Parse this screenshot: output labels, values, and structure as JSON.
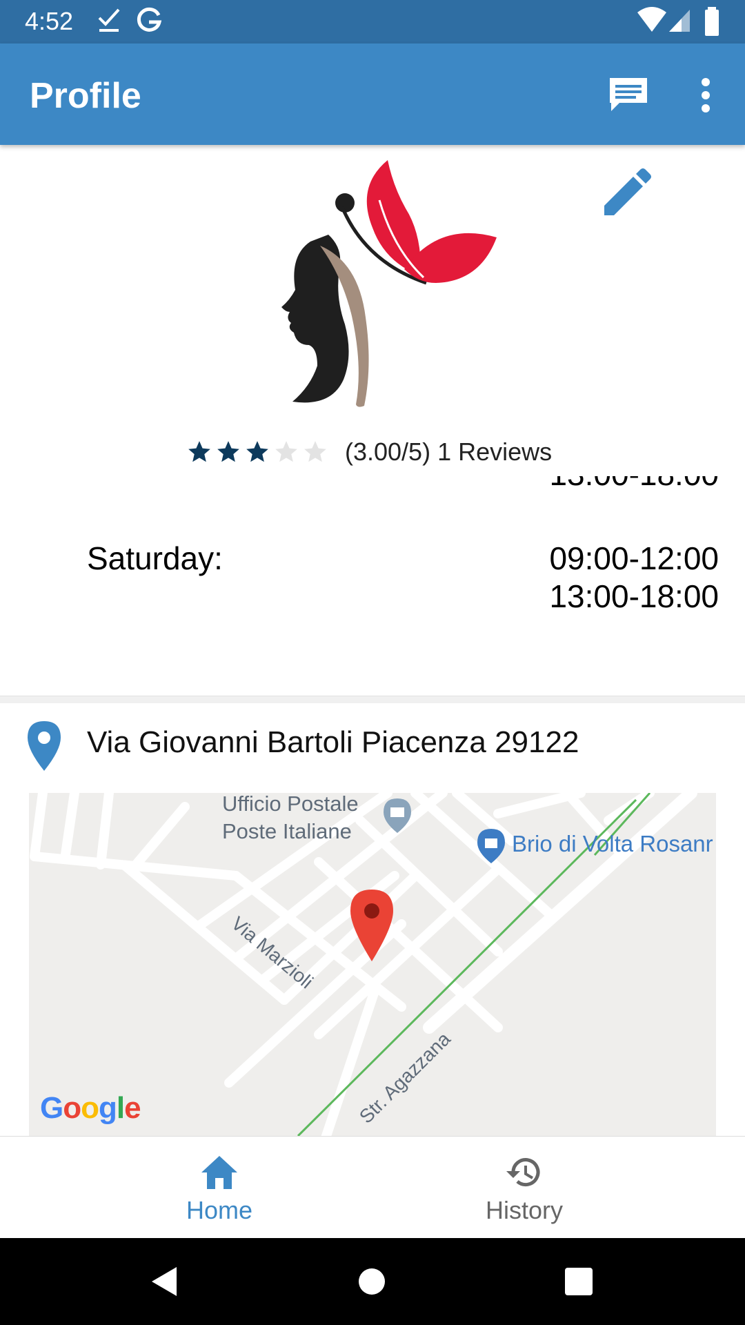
{
  "status_bar": {
    "time": "4:52"
  },
  "app_bar": {
    "title": "Profile"
  },
  "profile": {
    "rating": {
      "value": 3,
      "max": 5,
      "text": "(3.00/5) 1 Reviews"
    }
  },
  "hours": {
    "cut_off_text": "13:00-18:00",
    "day": "Saturday:",
    "time_1": "09:00-12:00",
    "time_2": "13:00-18:00"
  },
  "address": {
    "text": "Via Giovanni Bartoli Piacenza 29122"
  },
  "map": {
    "poi_1_line1": "Ufficio Postale",
    "poi_1_line2": "Poste Italiane",
    "poi_2": "Brio di Volta Rosanr",
    "street_1": "Via Marzioli",
    "street_2": "Str. Agazzana",
    "logo": "Google"
  },
  "bottom_nav": {
    "items": [
      {
        "label": "Home",
        "icon": "home-icon",
        "active": true
      },
      {
        "label": "History",
        "icon": "history-icon",
        "active": false
      }
    ]
  },
  "colors": {
    "status_bar": "#2f6ea3",
    "app_bar": "#3d88c5",
    "accent": "#3d88c5",
    "star_filled": "#0d3a5c",
    "star_empty": "#e3e3e3"
  }
}
